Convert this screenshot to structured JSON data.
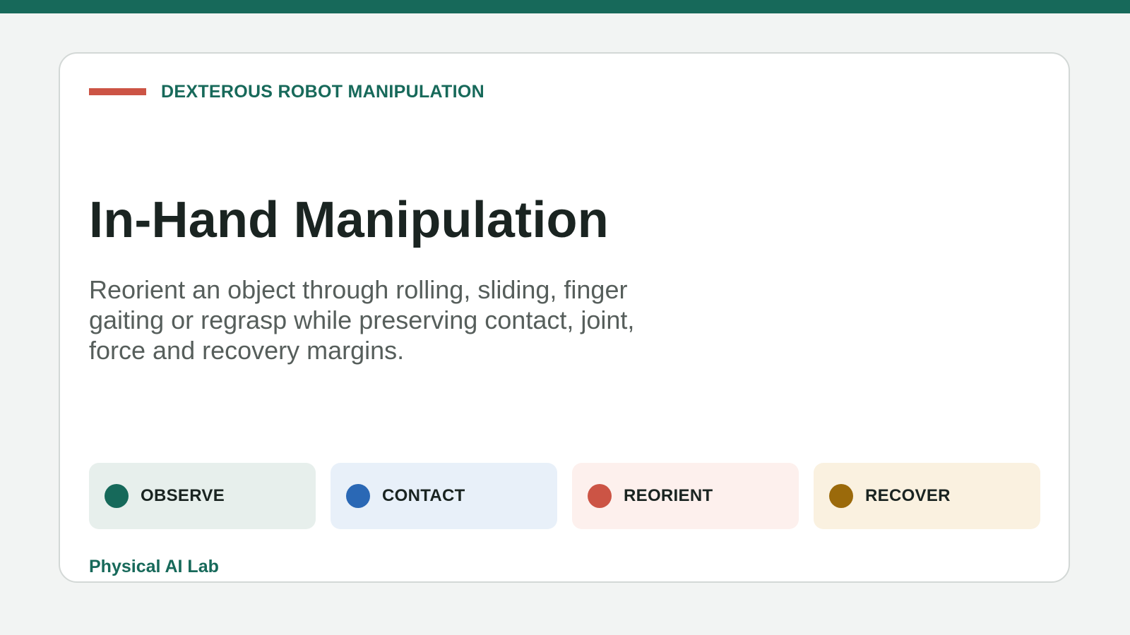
{
  "kicker": "DEXTEROUS ROBOT MANIPULATION",
  "title": "In-Hand Manipulation",
  "description": "Reorient an object through rolling, sliding, finger gaiting or regrasp while preserving contact, joint, force and recovery margins.",
  "stages": [
    {
      "label": "OBSERVE",
      "dot_color": "#16695a",
      "bg_color": "#e7efec"
    },
    {
      "label": "CONTACT",
      "dot_color": "#2a68b5",
      "bg_color": "#e8f0f9"
    },
    {
      "label": "REORIENT",
      "dot_color": "#cc5445",
      "bg_color": "#fdf0ed"
    },
    {
      "label": "RECOVER",
      "dot_color": "#9b6a0b",
      "bg_color": "#faf1e0"
    }
  ],
  "footer": "Physical AI Lab",
  "colors": {
    "accent": "#17695a",
    "kicker_bar": "#cc5445",
    "background": "#f2f4f3",
    "card": "#ffffff"
  }
}
